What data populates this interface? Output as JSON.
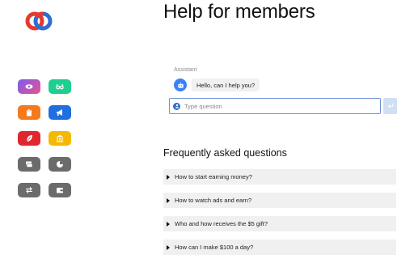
{
  "header": {
    "title": "Help for members"
  },
  "sidebar": {
    "buttons": [
      {
        "icon": "eye-icon",
        "color": "#a95bd8",
        "name": "sidebar-eye-button"
      },
      {
        "icon": "glasses-icon",
        "color": "#1fcf8f",
        "name": "sidebar-glasses-button"
      },
      {
        "icon": "clipboard-icon",
        "color": "#f47a1f",
        "name": "sidebar-clipboard-button"
      },
      {
        "icon": "megaphone-icon",
        "color": "#1f6fe0",
        "name": "sidebar-megaphone-button"
      },
      {
        "icon": "leaf-icon",
        "color": "#e0262e",
        "name": "sidebar-leaf-button"
      },
      {
        "icon": "bank-icon",
        "color": "#f5b800",
        "name": "sidebar-bank-button"
      },
      {
        "icon": "stack-icon",
        "color": "#6b6b6b",
        "name": "sidebar-stack-button"
      },
      {
        "icon": "pie-chart-icon",
        "color": "#6b6b6b",
        "name": "sidebar-chart-button"
      },
      {
        "icon": "transfer-icon",
        "color": "#6b6b6b",
        "name": "sidebar-transfer-button"
      },
      {
        "icon": "wallet-icon",
        "color": "#6b6b6b",
        "name": "sidebar-wallet-button"
      }
    ]
  },
  "chat": {
    "assistant_label": "Assistant",
    "greeting": "Hello, can I help you?",
    "input_placeholder": "Type question",
    "input_value": ""
  },
  "faq": {
    "title": "Frequently asked questions",
    "items": [
      "How to start earning money?",
      "How to watch ads and earn?",
      "Who and how receives the $5 gift?",
      "How can I make $100 a day?"
    ]
  },
  "colors": {
    "accent": "#2f6fd1",
    "send_bg": "#cfe0f5"
  }
}
